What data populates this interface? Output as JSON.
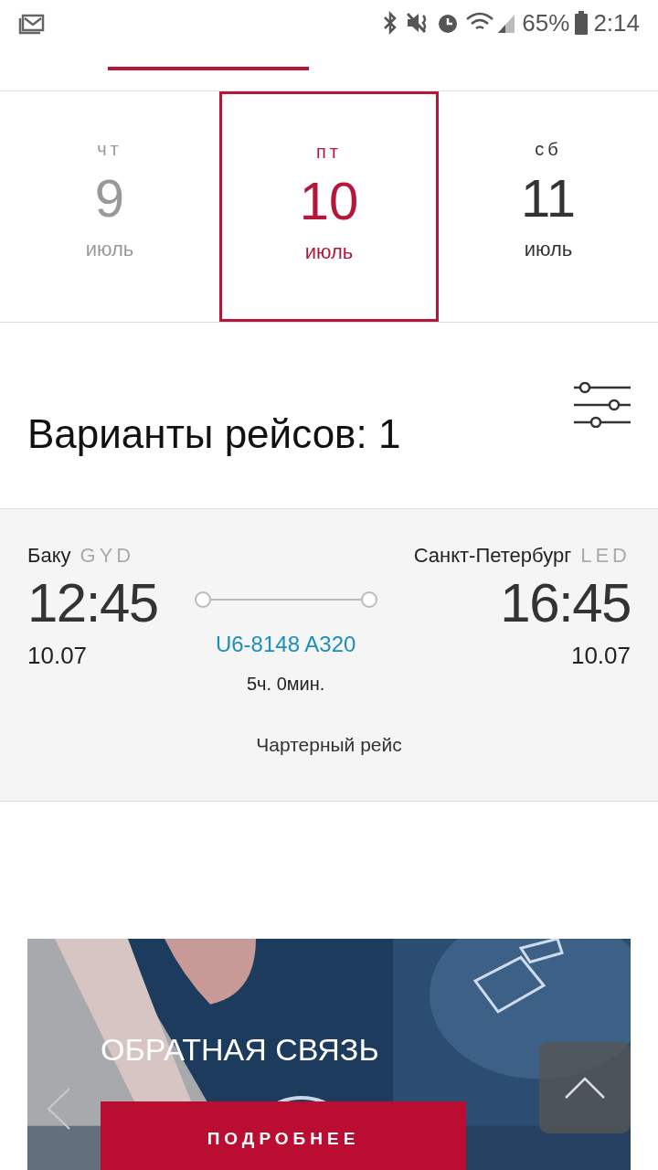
{
  "status_bar": {
    "battery": "65%",
    "time": "2:14"
  },
  "days": [
    {
      "weekday": "чт",
      "day": "9",
      "month": "июль",
      "selected": false,
      "disabled": true
    },
    {
      "weekday": "пт",
      "day": "10",
      "month": "июль",
      "selected": true,
      "disabled": false
    },
    {
      "weekday": "сб",
      "day": "11",
      "month": "июль",
      "selected": false,
      "disabled": false
    }
  ],
  "results_title": "Варианты рейсов: 1",
  "flight": {
    "from_city": "Баку",
    "from_code": "GYD",
    "to_city": "Санкт-Петербург",
    "to_code": "LED",
    "dep_time": "12:45",
    "arr_time": "16:45",
    "dep_date": "10.07",
    "arr_date": "10.07",
    "flight_number": "U6-8148 A320",
    "duration": "5ч. 0мин.",
    "note": "Чартерный рейс"
  },
  "banner": {
    "title": "ОБРАТНАЯ СВЯЗЬ",
    "button": "ПОДРОБНЕЕ"
  }
}
